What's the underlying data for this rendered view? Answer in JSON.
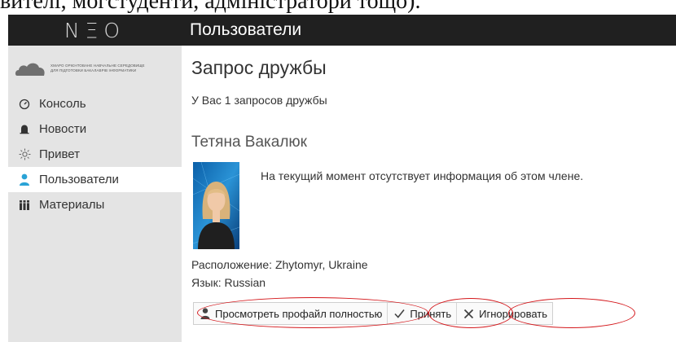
{
  "cropped_text": "вителі, могстуденти, адміністратори тощо).",
  "topbar": {
    "brand": "NΞO",
    "page_heading": "Пользователи"
  },
  "sidebar": {
    "logo_text": [
      "Хмаро орієнтоване навчальне середовище",
      "для підготовки бакалаврів інформатики"
    ],
    "items": [
      {
        "label": "Консоль",
        "icon": "dashboard-icon"
      },
      {
        "label": "Новости",
        "icon": "bell-icon"
      },
      {
        "label": "Привет",
        "icon": "sun-icon"
      },
      {
        "label": "Пользователи",
        "icon": "user-icon",
        "active": true
      },
      {
        "label": "Материалы",
        "icon": "books-icon"
      }
    ]
  },
  "main": {
    "title": "Запрос дружбы",
    "subtitle": "У Вас 1 запросов дружбы",
    "person_name": "Тетяна Вакалюк",
    "member_info": "На текущий момент отсутствует информация об этом члене.",
    "location": "Расположение: Zhytomyr, Ukraine",
    "language": "Язык: Russian",
    "actions": {
      "view_profile": "Просмотреть профайл полностью",
      "accept": "Принять",
      "ignore": "Игнорировать"
    }
  },
  "colors": {
    "topbar_bg": "#202020",
    "sidebar_bg": "#e4e4e4",
    "annotation_red": "#d4171b",
    "accent_blue": "#2aa3d6"
  }
}
